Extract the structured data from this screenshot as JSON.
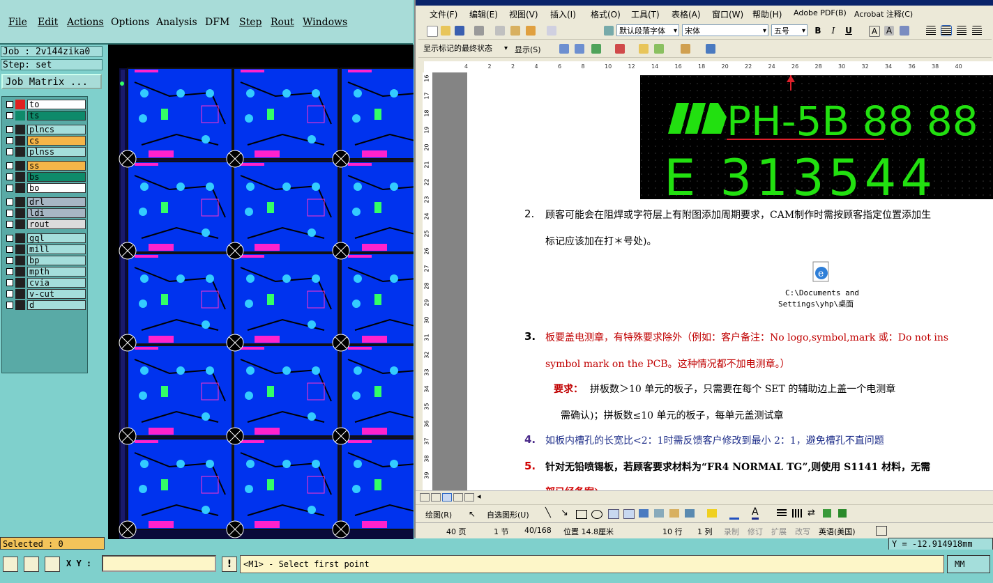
{
  "cam": {
    "menu": [
      "File",
      "Edit",
      "Actions",
      "Options",
      "Analysis",
      "DFM",
      "Step",
      "Rout",
      "Windows"
    ],
    "job_label": "Job : 2v144zika0",
    "step_label": "Step: set",
    "job_matrix_button": "Job Matrix ...",
    "layers": [
      {
        "name": "to",
        "bg": "#ffffff",
        "sw": "#e02020"
      },
      {
        "name": "ts",
        "bg": "#0e8a6a",
        "sw": "#0e8a6a"
      },
      {
        "name": "plncs",
        "bg": "#a4dedb",
        "sw": "#222222"
      },
      {
        "name": "cs",
        "bg": "#f5b548",
        "sw": "#222222"
      },
      {
        "name": "plnss",
        "bg": "#a4dedb",
        "sw": "#222222"
      },
      {
        "name": "ss",
        "bg": "#f5b548",
        "sw": "#222222"
      },
      {
        "name": "bs",
        "bg": "#0e8a6a",
        "sw": "#222222"
      },
      {
        "name": "bo",
        "bg": "#ffffff",
        "sw": "#222222"
      },
      {
        "name": "drl",
        "bg": "#a7b6c4",
        "sw": "#222222"
      },
      {
        "name": "ldi",
        "bg": "#a7b6c4",
        "sw": "#222222"
      },
      {
        "name": "rout",
        "bg": "#dcdcdc",
        "sw": "#222222"
      },
      {
        "name": "gql",
        "bg": "#a4dedb",
        "sw": "#222222"
      },
      {
        "name": "mill",
        "bg": "#a4dedb",
        "sw": "#222222"
      },
      {
        "name": "bp",
        "bg": "#a4dedb",
        "sw": "#222222"
      },
      {
        "name": "mpth",
        "bg": "#a4dedb",
        "sw": "#222222"
      },
      {
        "name": "cvia",
        "bg": "#a4dedb",
        "sw": "#222222"
      },
      {
        "name": "v-cut",
        "bg": "#a4dedb",
        "sw": "#222222"
      },
      {
        "name": "d",
        "bg": "#a4dedb",
        "sw": "#222222"
      }
    ],
    "selected_label": "Selected : 0",
    "xy_label": "X Y :",
    "xy_value": "",
    "message": "<M1> - Select first point",
    "units": "MM",
    "y_coord": "Y = -12.914918mm"
  },
  "word": {
    "menu": [
      "文件(F)",
      "编辑(E)",
      "视图(V)",
      "插入(I)",
      "格式(O)",
      "工具(T)",
      "表格(A)",
      "窗口(W)",
      "帮助(H)",
      "Adobe PDF(B)",
      "Acrobat 注释(C)"
    ],
    "style_combo": "默认段落字体",
    "font_combo": "宋体",
    "size_combo": "五号",
    "markup_combo": "显示标记的最终状态",
    "show_label": "显示(S)",
    "banner": {
      "line1": "PH-5B 88 88",
      "line2": "E 313544"
    },
    "items": [
      {
        "num": "2.",
        "lines": [
          "顾客可能会在阻焊或字符层上有附图添加周期要求，CAM制作时需按顾客指定位置添加生",
          "标记应该加在打＊号处)。"
        ]
      },
      {
        "num": "3.",
        "lines": [
          "板要盖电测章，有特殊要求除外（例如：客户备注：No logo,symbol,mark 或：Do not ins",
          "symbol mark on the PCB。这种情况都不加电测章。）"
        ]
      },
      {
        "num": "4.",
        "lines": [
          "如板内槽孔的长宽比<2：1时需反馈客户修改到最小 2：1，避免槽孔不直问题"
        ]
      },
      {
        "num": "5.",
        "lines": [
          "针对无铅喷锡板，若顾客要求材料为“FR4 NORMAL TG”,则使用 S1141 材料，无需",
          "部已经备案)"
        ]
      }
    ],
    "req_label": "要求：",
    "req_lines": [
      "拼板数＞10 单元的板子，只需要在每个 SET 的辅助边上盖一个电测章",
      "需确认)；拼板数≤10 单元的板子，每单元盖测试章"
    ],
    "file_caption": [
      "C:\\Documents and",
      "Settings\\yhp\\桌面"
    ],
    "draw_label": "绘图(R)",
    "autoshape_label": "自选图形(U)",
    "status": [
      "40 页",
      "1 节",
      "40/168",
      "位置 14.8厘米",
      "10 行",
      "1 列",
      "录制",
      "修订",
      "扩展",
      "改写",
      "英语(美国)"
    ],
    "ruler_numbers": [
      "4",
      "2",
      "2",
      "4",
      "6",
      "8",
      "10",
      "12",
      "14",
      "16",
      "18",
      "20",
      "22",
      "24",
      "26",
      "28",
      "30",
      "32",
      "34",
      "36",
      "38",
      "40"
    ],
    "vruler_numbers": [
      "16",
      "17",
      "18",
      "19",
      "20",
      "21",
      "22",
      "23",
      "24",
      "25",
      "26",
      "27",
      "28",
      "29",
      "30",
      "31",
      "32",
      "33",
      "34",
      "35",
      "36",
      "37",
      "38",
      "39"
    ]
  }
}
